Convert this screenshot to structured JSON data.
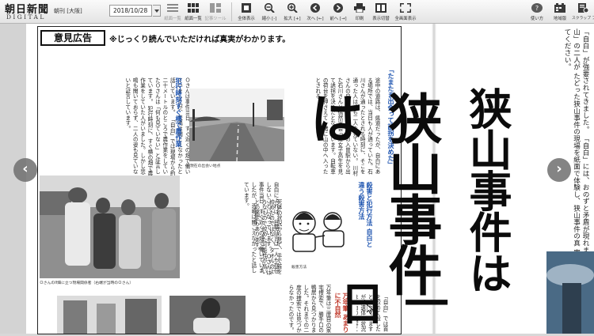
{
  "app": {
    "logo_main": "朝日新聞",
    "logo_sub": "DIGITAL",
    "edition": "朝刊 [大阪]",
    "date": "2018/10/28"
  },
  "toolbar": {
    "view_modes": [
      {
        "label": "紙面一覧",
        "icon": "list-icon"
      },
      {
        "label": "紙面一覧",
        "icon": "grid-icon"
      },
      {
        "label": "記事ツール",
        "icon": "layout-icon"
      }
    ],
    "actions": [
      {
        "label": "全体表示",
        "icon": "fit-page-icon"
      },
      {
        "label": "縮小 [-]",
        "icon": "zoom-out-icon"
      },
      {
        "label": "拡大 [+]",
        "icon": "zoom-in-icon"
      },
      {
        "label": "次へ [←]",
        "icon": "next-page-icon"
      },
      {
        "label": "前へ [→]",
        "icon": "prev-page-icon"
      },
      {
        "label": "印刷",
        "icon": "print-icon"
      },
      {
        "label": "表示切替",
        "icon": "display-toggle-icon"
      },
      {
        "label": "全画面表示",
        "icon": "fullscreen-icon"
      }
    ],
    "right": [
      {
        "label": "使い方",
        "icon": "help-icon"
      },
      {
        "label": "地域版",
        "icon": "region-icon"
      },
      {
        "label": "スクラップ ブック",
        "icon": "scrapbook-icon"
      }
    ]
  },
  "newspaper": {
    "ad_label": "意見広告",
    "ad_subtitle": "※じっくり読んでいただければ真実がわかります。",
    "headlines": {
      "h1": "「たまたま出会って誘拐を決めた」",
      "h2": "犯行時刻すぐ横で農作業",
      "h3": "殺害と犯行方法",
      "h3b": "自白と違う殺害方法",
      "h4": "万年筆",
      "h4b": "あまりに不自然"
    },
    "columns": {
      "c1": "川村さんの自白では、狭山市の入曽駅から出た石川さんと偶然出会った女子高生を見て誘拐を決めたとなっています。自転車の荷台を押さえて一緒に山の中へ入ったとされる。",
      "c2": "途中の道路は、県道だったが、自白にある場所では、当日も人が通っていた。石川さんが通ったとされる時刻に、そこを通った人は誰も二人を見ていない。",
      "c3": "自白によれば、目撃証言は一人も存在しないことになっています。",
      "c4": "犯行時刻に、すぐ横の畑で農作業をしていた人がいました。しかし悲鳴も聞いておらず、二人の姿も見ていないと証言しています。",
      "c5": "「自白」では現場から約二十メートルのところで農作業をしていたＯさんは「何も見ていない」と証言しています。",
      "c6": "Ｏさんは事件当日、すぐ近くの畑で働いていましたが、悲鳴は聞こえなかったと話しています。",
      "c7": "「自白」では首を絞めて殺したとされていますが、遺体の状況は自白の内容と一致しません。",
      "c8": "自白と違う殺害方法の可能性が専門家から指摘されています。",
      "c9": "死体の状況から見て、手で首を絞めたのではなく、タオルのようなもので絞めた可能性が高いとの鑑定もあります。",
      "c10": "万年筆は三度目の家宅捜索で、勝手口の鴨居から見つかりました。それまでの二度の捜索では見つからなかったのです。",
      "right1": "「自白」が強要されてきました。",
      "right2": "「自白」には、おのずと矛盾が現れます。「狭山」の二人が",
      "right3": "たどった狭山事件の現場を紙面で体験し、狭山事件の真",
      "right4": "実を感じてください。"
    },
    "captions": {
      "photo_road": "現在の出会い地点",
      "photo_people": "ＯさんのIf畑に立つ現場関係者（右端が当時のＯさん）",
      "illus": "殺害方法"
    },
    "big_title": "狭山事件は",
    "big_title_bottom": "一日"
  },
  "nav": {
    "prev_label": "‹",
    "next_label": "›"
  }
}
